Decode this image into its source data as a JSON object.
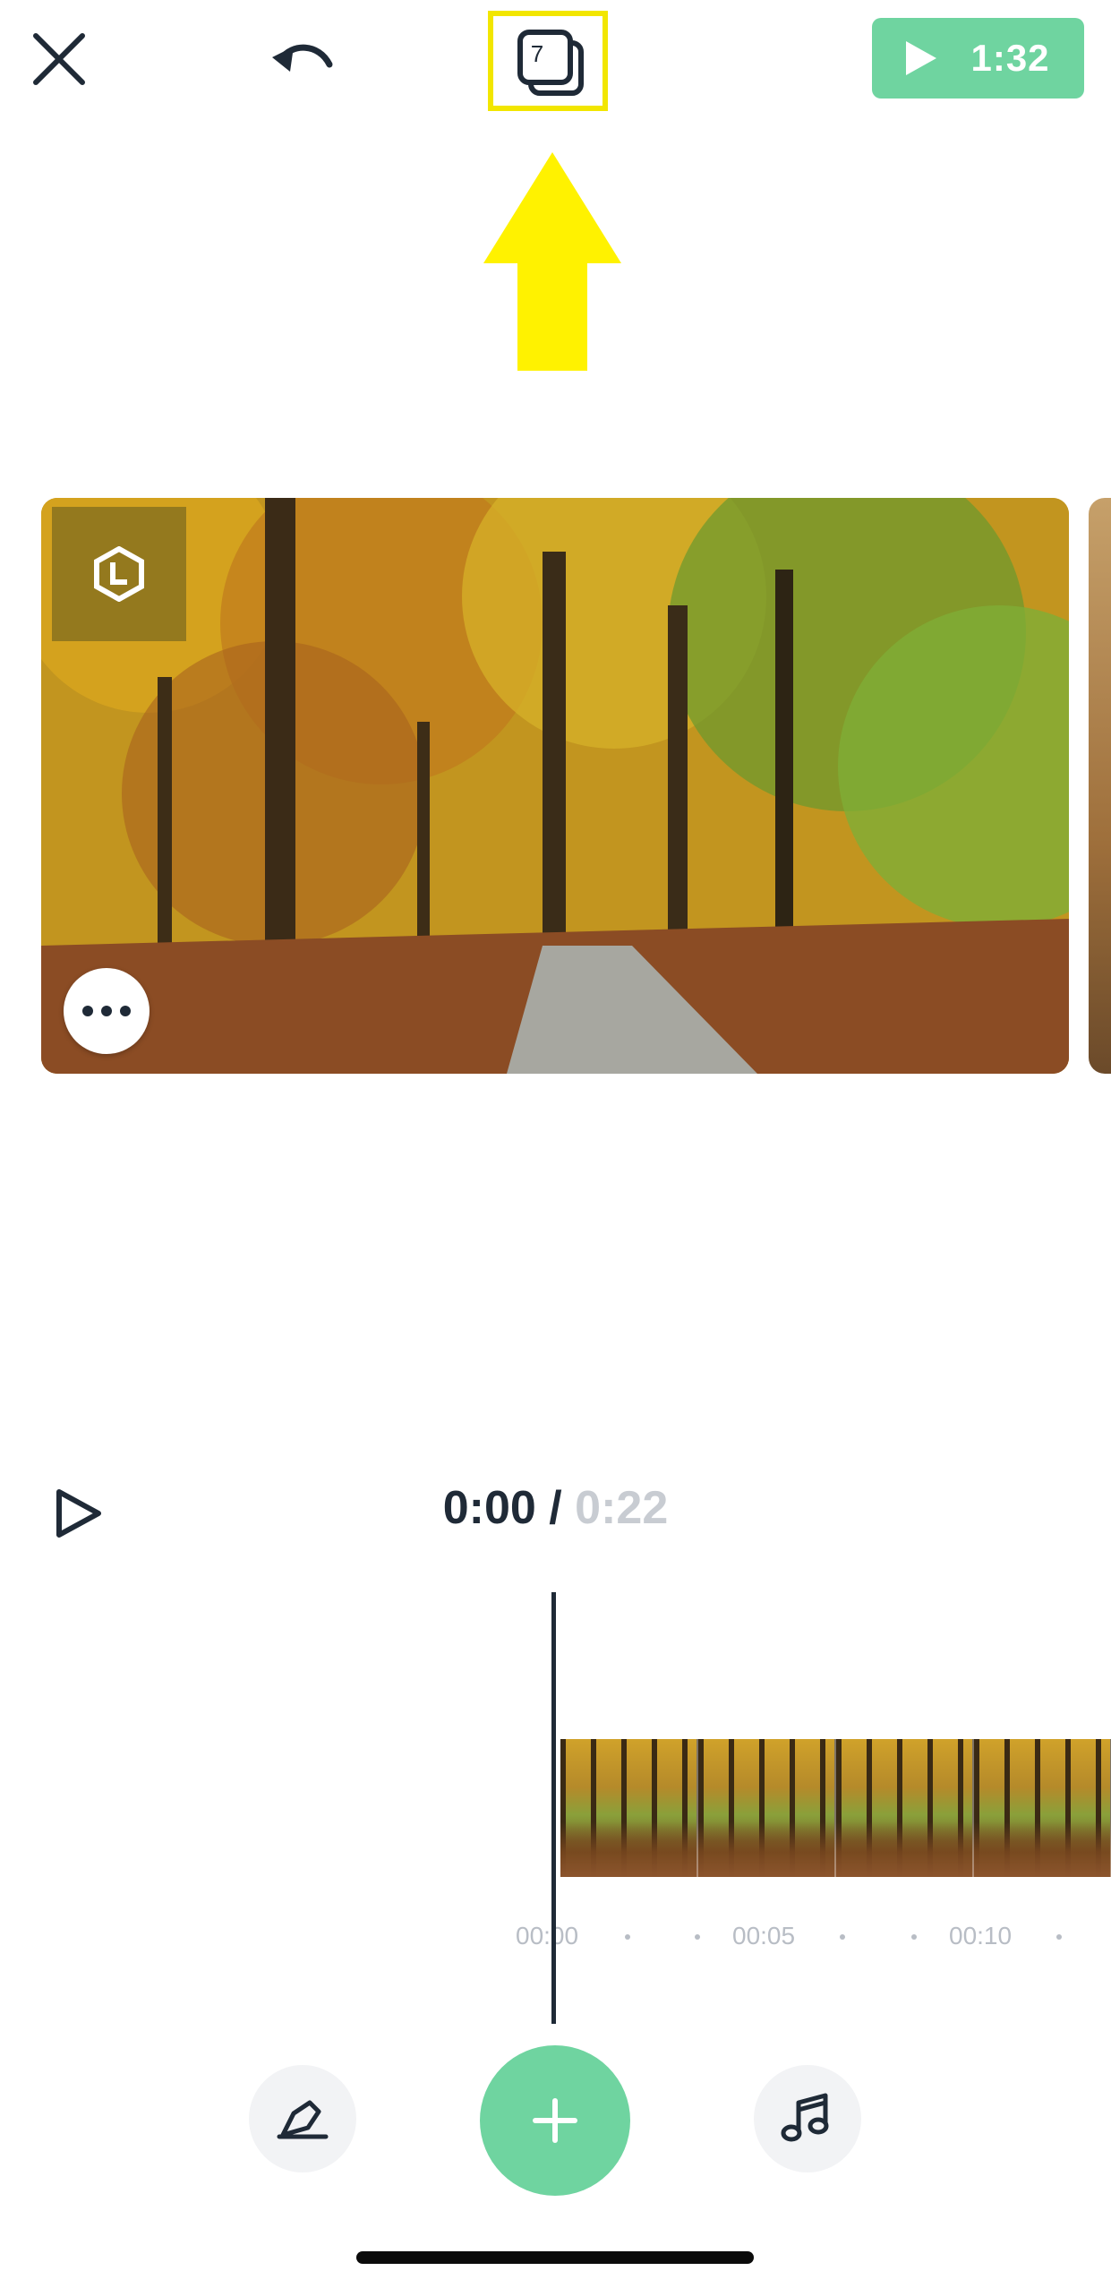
{
  "top_bar": {
    "close_icon": "close-icon",
    "undo_icon": "undo-icon",
    "clips_count": "7",
    "preview_duration": "1:32",
    "accent_color": "#6fd4a0",
    "highlight_color": "#f2e600"
  },
  "player": {
    "current_time": "0:00",
    "separator": "/",
    "total_time": "0:22"
  },
  "timeline": {
    "ruler_labels": [
      "00:00",
      "00:05",
      "00:10"
    ]
  },
  "tools": {
    "edit_icon": "pen-icon",
    "add_icon": "plus-icon",
    "music_icon": "music-note-icon"
  }
}
